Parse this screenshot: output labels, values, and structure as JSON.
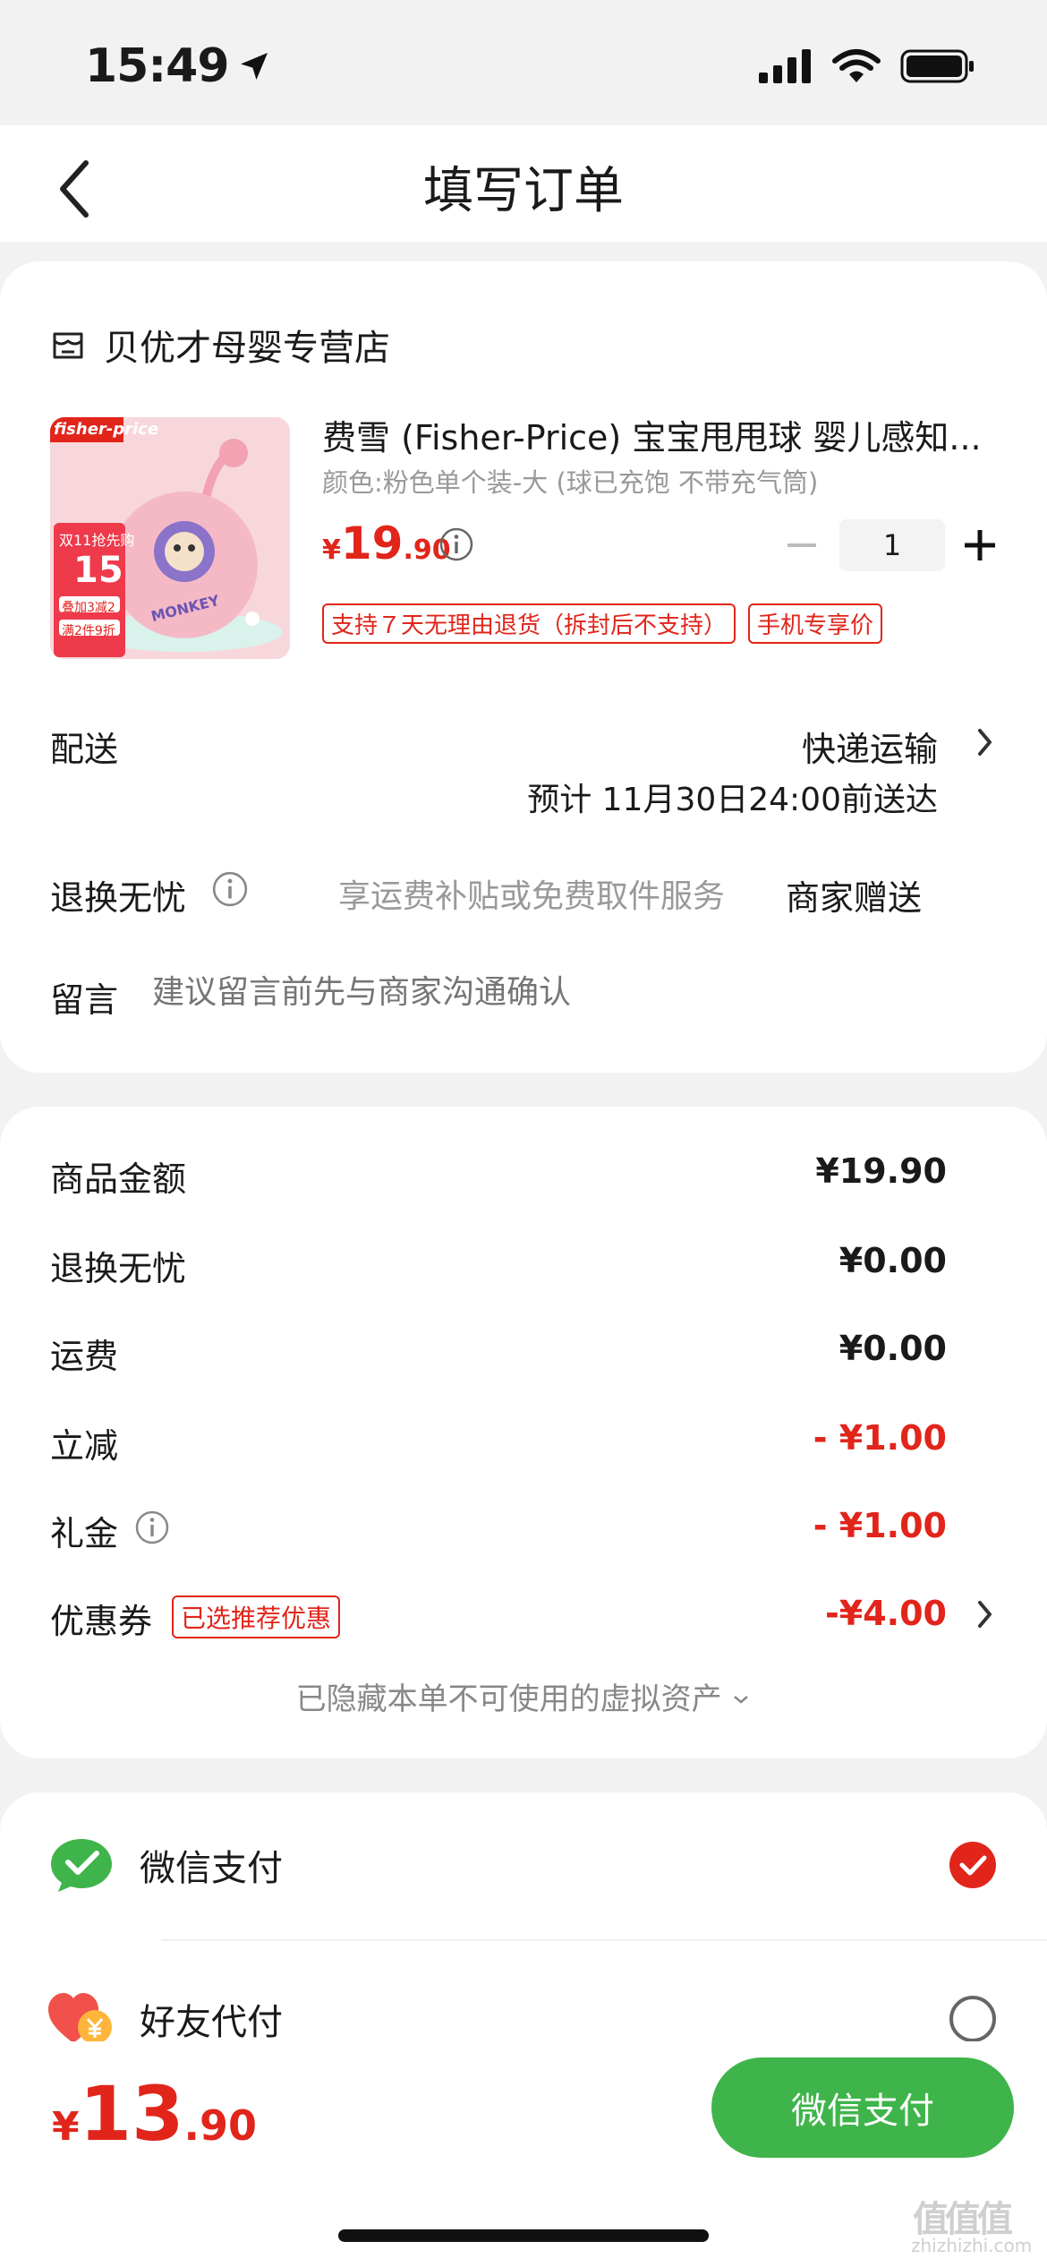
{
  "status": {
    "time": "15:49"
  },
  "nav": {
    "title": "填写订单"
  },
  "store": {
    "name": "贝优才母婴专营店"
  },
  "product": {
    "title": "费雪 (Fisher-Price) 宝宝甩甩球 婴儿感知...",
    "spec": "颜色:粉色单个装-大 (球已充饱 不带充气筒)",
    "price_symbol": "¥",
    "price_int": "19",
    "price_dec": ".90",
    "quantity": "1",
    "tags": [
      "支持７天无理由退货（拆封后不支持）",
      "手机专享价"
    ],
    "thumb_brand": "fisher-price",
    "thumb_promo_head": "双11抢先购",
    "thumb_promo_price": "15",
    "thumb_promo_lines": [
      "叠加3减2",
      "满2件9折"
    ],
    "thumb_toy_text": "MONKEY"
  },
  "delivery": {
    "label": "配送",
    "method": "快递运输",
    "eta": "预计 11月30日24:00前送达"
  },
  "worry_free": {
    "label": "退换无忧",
    "desc": "享运费补贴或免费取件服务",
    "value": "商家赠送"
  },
  "message": {
    "label": "留言",
    "placeholder": "建议留言前先与商家沟通确认"
  },
  "fees": [
    {
      "label": "商品金额",
      "value": "¥19.90",
      "red": false
    },
    {
      "label": "退换无忧",
      "value": "¥0.00",
      "red": false
    },
    {
      "label": "运费",
      "value": "¥0.00",
      "red": false
    },
    {
      "label": "立减",
      "value": "- ¥1.00",
      "red": true
    },
    {
      "label": "礼金",
      "value": "- ¥1.00",
      "red": true
    },
    {
      "label": "优惠券",
      "value": "-¥4.00",
      "red": true
    }
  ],
  "coupon_tag": "已选推荐优惠",
  "hidden_assets": "已隐藏本单不可使用的虚拟资产",
  "payment": {
    "wechat": "微信支付",
    "friend": "好友代付"
  },
  "bottom": {
    "total_symbol": "¥",
    "total_int": "13",
    "total_dec": ".90",
    "pay_button": "微信支付"
  },
  "watermark": {
    "logo": "值值值",
    "site": "zhizhizhi.com"
  },
  "colors": {
    "accent_red": "#e1251b",
    "wechat_green": "#3fb44a"
  }
}
